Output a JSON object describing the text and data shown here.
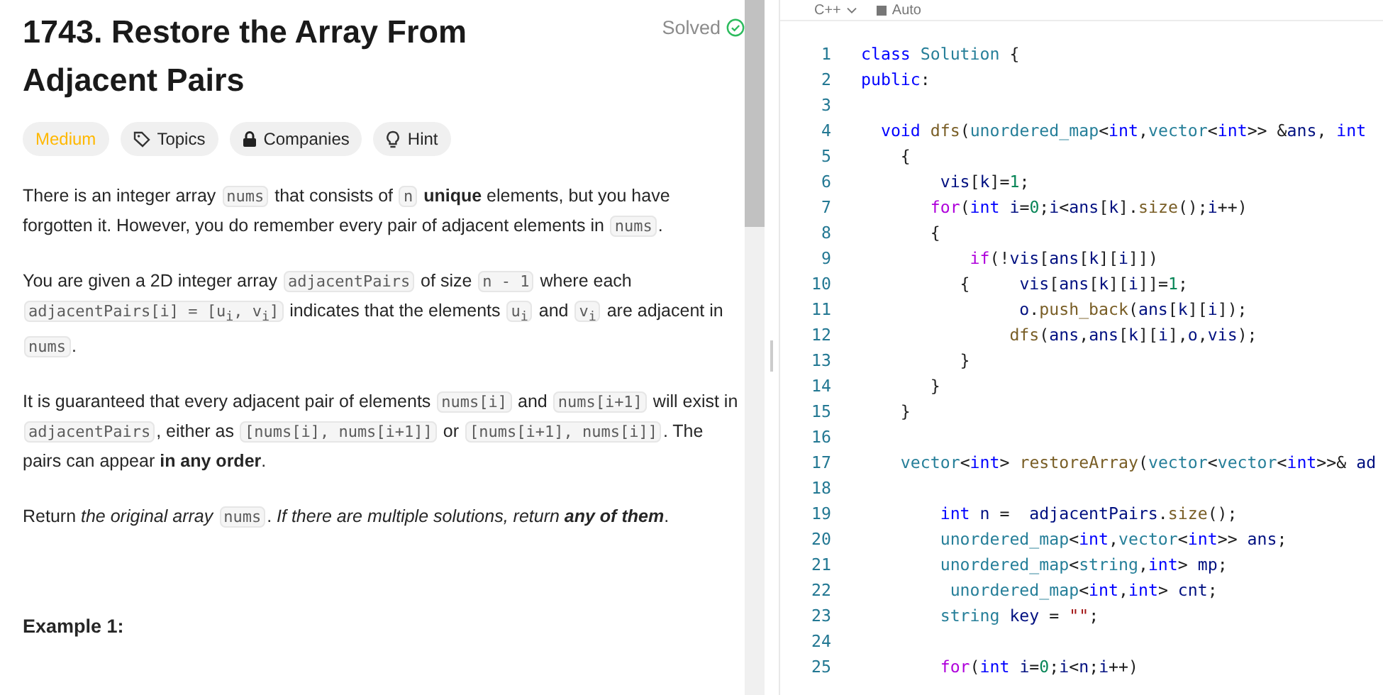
{
  "problem": {
    "title": "1743. Restore the Array From Adjacent Pairs",
    "status": "Solved",
    "difficulty": {
      "kind": "medium",
      "label": "Medium"
    },
    "tags": [
      {
        "kind": "topics",
        "label": "Topics"
      },
      {
        "kind": "companies",
        "label": "Companies"
      },
      {
        "kind": "hint",
        "label": "Hint"
      }
    ],
    "paragraphs": [
      [
        {
          "kind": "text",
          "text": "There is an integer array "
        },
        {
          "kind": "code",
          "text": "nums"
        },
        {
          "kind": "text",
          "text": " that consists of "
        },
        {
          "kind": "code",
          "text": "n"
        },
        {
          "kind": "text",
          "text": " **unique** elements, but you have forgotten it. However, you do remember every pair of adjacent elements in "
        },
        {
          "kind": "code",
          "text": "nums"
        },
        {
          "kind": "text",
          "text": "."
        }
      ],
      [
        {
          "kind": "text",
          "text": "You are given a 2D integer array "
        },
        {
          "kind": "code",
          "text": "adjacentPairs"
        },
        {
          "kind": "text",
          "text": " of size "
        },
        {
          "kind": "code",
          "text": "n - 1"
        },
        {
          "kind": "text",
          "text": " where each "
        },
        {
          "kind": "code",
          "text": "adjacentPairs[i] = [u$_{i}$, v$_{i}$]"
        },
        {
          "kind": "text",
          "text": " indicates that the elements "
        },
        {
          "kind": "code",
          "text": "u$_{i}$"
        },
        {
          "kind": "text",
          "text": " and "
        },
        {
          "kind": "code",
          "text": "v$_{i}$"
        },
        {
          "kind": "text",
          "text": " are adjacent in "
        },
        {
          "kind": "code",
          "text": "nums"
        },
        {
          "kind": "text",
          "text": "."
        }
      ],
      [
        {
          "kind": "text",
          "text": "It is guaranteed that every adjacent pair of elements "
        },
        {
          "kind": "code",
          "text": "nums[i]"
        },
        {
          "kind": "text",
          "text": " and "
        },
        {
          "kind": "code",
          "text": "nums[i+1]"
        },
        {
          "kind": "text",
          "text": " will exist in "
        },
        {
          "kind": "code",
          "text": "adjacentPairs"
        },
        {
          "kind": "text",
          "text": ", either as "
        },
        {
          "kind": "code",
          "text": "[nums[i], nums[i+1]]"
        },
        {
          "kind": "text",
          "text": " or "
        },
        {
          "kind": "code",
          "text": "[nums[i+1], nums[i]]"
        },
        {
          "kind": "text",
          "text": ". The pairs can appear **in any order**."
        }
      ],
      [
        {
          "kind": "text",
          "text": "Return "
        },
        {
          "kind": "italic",
          "text": "the original array "
        },
        {
          "kind": "code",
          "text": "nums"
        },
        {
          "kind": "text",
          "text": ". "
        },
        {
          "kind": "italic",
          "text": "If there are multiple solutions, return **any of them**"
        },
        {
          "kind": "text",
          "text": "."
        }
      ]
    ],
    "example_heading": "Example 1:"
  },
  "editor": {
    "language": "C++",
    "mode": "Auto",
    "lines": [
      {
        "number": "1",
        "tokens": [
          {
            "text": "class ",
            "kind": "kw"
          },
          {
            "text": "Solution",
            "kind": "type"
          },
          {
            "text": " {",
            "kind": "p"
          }
        ]
      },
      {
        "number": "2",
        "tokens": [
          {
            "text": "public",
            "kind": "kw"
          },
          {
            "text": ":",
            "kind": "p"
          }
        ]
      },
      {
        "number": "3"
      },
      {
        "number": "4",
        "tokens": [
          {
            "text": "  void ",
            "kind": "kw"
          },
          {
            "text": "dfs",
            "kind": "fn"
          },
          {
            "text": "(",
            "kind": "p"
          },
          {
            "text": "unordered_map",
            "kind": "type"
          },
          {
            "text": "<",
            "kind": "p"
          },
          {
            "text": "int",
            "kind": "kw"
          },
          {
            "text": ",",
            "kind": "p"
          },
          {
            "text": "vector",
            "kind": "type"
          },
          {
            "text": "<",
            "kind": "p"
          },
          {
            "text": "int",
            "kind": "kw"
          },
          {
            "text": ">> &",
            "kind": "p"
          },
          {
            "text": "ans",
            "kind": "var"
          },
          {
            "text": ", ",
            "kind": "p"
          },
          {
            "text": "int",
            "kind": "kw"
          }
        ]
      },
      {
        "number": "5",
        "tokens": [
          {
            "text": "    {",
            "kind": "p"
          }
        ]
      },
      {
        "number": "6",
        "tokens": [
          {
            "text": "        vis",
            "kind": "var"
          },
          {
            "text": "[",
            "kind": "p"
          },
          {
            "text": "k",
            "kind": "var"
          },
          {
            "text": "]=",
            "kind": "p"
          },
          {
            "text": "1",
            "kind": "num"
          },
          {
            "text": ";",
            "kind": "p"
          }
        ]
      },
      {
        "number": "7",
        "tokens": [
          {
            "text": "       for",
            "kind": "ctrl"
          },
          {
            "text": "(",
            "kind": "p"
          },
          {
            "text": "int ",
            "kind": "kw"
          },
          {
            "text": "i",
            "kind": "var"
          },
          {
            "text": "=",
            "kind": "p"
          },
          {
            "text": "0",
            "kind": "num"
          },
          {
            "text": ";",
            "kind": "p"
          },
          {
            "text": "i",
            "kind": "var"
          },
          {
            "text": "<",
            "kind": "p"
          },
          {
            "text": "ans",
            "kind": "var"
          },
          {
            "text": "[",
            "kind": "p"
          },
          {
            "text": "k",
            "kind": "var"
          },
          {
            "text": "].",
            "kind": "p"
          },
          {
            "text": "size",
            "kind": "fn"
          },
          {
            "text": "();",
            "kind": "p"
          },
          {
            "text": "i",
            "kind": "var"
          },
          {
            "text": "++)",
            "kind": "p"
          }
        ]
      },
      {
        "number": "8",
        "tokens": [
          {
            "text": "       {",
            "kind": "p"
          }
        ]
      },
      {
        "number": "9",
        "tokens": [
          {
            "text": "           if",
            "kind": "ctrl"
          },
          {
            "text": "(!",
            "kind": "p"
          },
          {
            "text": "vis",
            "kind": "var"
          },
          {
            "text": "[",
            "kind": "p"
          },
          {
            "text": "ans",
            "kind": "var"
          },
          {
            "text": "[",
            "kind": "p"
          },
          {
            "text": "k",
            "kind": "var"
          },
          {
            "text": "][",
            "kind": "p"
          },
          {
            "text": "i",
            "kind": "var"
          },
          {
            "text": "]])",
            "kind": "p"
          }
        ]
      },
      {
        "number": "10",
        "tokens": [
          {
            "text": "          {     ",
            "kind": "p"
          },
          {
            "text": "vis",
            "kind": "var"
          },
          {
            "text": "[",
            "kind": "p"
          },
          {
            "text": "ans",
            "kind": "var"
          },
          {
            "text": "[",
            "kind": "p"
          },
          {
            "text": "k",
            "kind": "var"
          },
          {
            "text": "][",
            "kind": "p"
          },
          {
            "text": "i",
            "kind": "var"
          },
          {
            "text": "]]=",
            "kind": "p"
          },
          {
            "text": "1",
            "kind": "num"
          },
          {
            "text": ";",
            "kind": "p"
          }
        ]
      },
      {
        "number": "11",
        "tokens": [
          {
            "text": "                o",
            "kind": "var"
          },
          {
            "text": ".",
            "kind": "p"
          },
          {
            "text": "push_back",
            "kind": "fn"
          },
          {
            "text": "(",
            "kind": "p"
          },
          {
            "text": "ans",
            "kind": "var"
          },
          {
            "text": "[",
            "kind": "p"
          },
          {
            "text": "k",
            "kind": "var"
          },
          {
            "text": "][",
            "kind": "p"
          },
          {
            "text": "i",
            "kind": "var"
          },
          {
            "text": "]);",
            "kind": "p"
          }
        ]
      },
      {
        "number": "12",
        "tokens": [
          {
            "text": "               dfs",
            "kind": "fn"
          },
          {
            "text": "(",
            "kind": "p"
          },
          {
            "text": "ans",
            "kind": "var"
          },
          {
            "text": ",",
            "kind": "p"
          },
          {
            "text": "ans",
            "kind": "var"
          },
          {
            "text": "[",
            "kind": "p"
          },
          {
            "text": "k",
            "kind": "var"
          },
          {
            "text": "][",
            "kind": "p"
          },
          {
            "text": "i",
            "kind": "var"
          },
          {
            "text": "],",
            "kind": "p"
          },
          {
            "text": "o",
            "kind": "var"
          },
          {
            "text": ",",
            "kind": "p"
          },
          {
            "text": "vis",
            "kind": "var"
          },
          {
            "text": ");",
            "kind": "p"
          }
        ]
      },
      {
        "number": "13",
        "tokens": [
          {
            "text": "          }",
            "kind": "p"
          }
        ]
      },
      {
        "number": "14",
        "tokens": [
          {
            "text": "       }",
            "kind": "p"
          }
        ]
      },
      {
        "number": "15",
        "tokens": [
          {
            "text": "    }",
            "kind": "p"
          }
        ]
      },
      {
        "number": "16"
      },
      {
        "number": "17",
        "tokens": [
          {
            "text": "    vector",
            "kind": "type"
          },
          {
            "text": "<",
            "kind": "p"
          },
          {
            "text": "int",
            "kind": "kw"
          },
          {
            "text": "> ",
            "kind": "p"
          },
          {
            "text": "restoreArray",
            "kind": "fn"
          },
          {
            "text": "(",
            "kind": "p"
          },
          {
            "text": "vector",
            "kind": "type"
          },
          {
            "text": "<",
            "kind": "p"
          },
          {
            "text": "vector",
            "kind": "type"
          },
          {
            "text": "<",
            "kind": "p"
          },
          {
            "text": "int",
            "kind": "kw"
          },
          {
            "text": ">>& ",
            "kind": "p"
          },
          {
            "text": "ad",
            "kind": "var"
          }
        ]
      },
      {
        "number": "18"
      },
      {
        "number": "19",
        "tokens": [
          {
            "text": "        int ",
            "kind": "kw"
          },
          {
            "text": "n",
            "kind": "var"
          },
          {
            "text": " =  ",
            "kind": "p"
          },
          {
            "text": "adjacentPairs",
            "kind": "var"
          },
          {
            "text": ".",
            "kind": "p"
          },
          {
            "text": "size",
            "kind": "fn"
          },
          {
            "text": "();",
            "kind": "p"
          }
        ]
      },
      {
        "number": "20",
        "tokens": [
          {
            "text": "        unordered_map",
            "kind": "type"
          },
          {
            "text": "<",
            "kind": "p"
          },
          {
            "text": "int",
            "kind": "kw"
          },
          {
            "text": ",",
            "kind": "p"
          },
          {
            "text": "vector",
            "kind": "type"
          },
          {
            "text": "<",
            "kind": "p"
          },
          {
            "text": "int",
            "kind": "kw"
          },
          {
            "text": ">> ",
            "kind": "p"
          },
          {
            "text": "ans",
            "kind": "var"
          },
          {
            "text": ";",
            "kind": "p"
          }
        ]
      },
      {
        "number": "21",
        "tokens": [
          {
            "text": "        unordered_map",
            "kind": "type"
          },
          {
            "text": "<",
            "kind": "p"
          },
          {
            "text": "string",
            "kind": "type"
          },
          {
            "text": ",",
            "kind": "p"
          },
          {
            "text": "int",
            "kind": "kw"
          },
          {
            "text": "> ",
            "kind": "p"
          },
          {
            "text": "mp",
            "kind": "var"
          },
          {
            "text": ";",
            "kind": "p"
          }
        ]
      },
      {
        "number": "22",
        "tokens": [
          {
            "text": "         unordered_map",
            "kind": "type"
          },
          {
            "text": "<",
            "kind": "p"
          },
          {
            "text": "int",
            "kind": "kw"
          },
          {
            "text": ",",
            "kind": "p"
          },
          {
            "text": "int",
            "kind": "kw"
          },
          {
            "text": "> ",
            "kind": "p"
          },
          {
            "text": "cnt",
            "kind": "var"
          },
          {
            "text": ";",
            "kind": "p"
          }
        ]
      },
      {
        "number": "23",
        "tokens": [
          {
            "text": "        string ",
            "kind": "type"
          },
          {
            "text": "key",
            "kind": "var"
          },
          {
            "text": " = ",
            "kind": "p"
          },
          {
            "text": "\"\"",
            "kind": "str"
          },
          {
            "text": ";",
            "kind": "p"
          }
        ]
      },
      {
        "number": "24"
      },
      {
        "number": "25",
        "tokens": [
          {
            "text": "        for",
            "kind": "ctrl"
          },
          {
            "text": "(",
            "kind": "p"
          },
          {
            "text": "int ",
            "kind": "kw"
          },
          {
            "text": "i",
            "kind": "var"
          },
          {
            "text": "=",
            "kind": "p"
          },
          {
            "text": "0",
            "kind": "num"
          },
          {
            "text": ";",
            "kind": "p"
          },
          {
            "text": "i",
            "kind": "var"
          },
          {
            "text": "<",
            "kind": "p"
          },
          {
            "text": "n",
            "kind": "var"
          },
          {
            "text": ";",
            "kind": "p"
          },
          {
            "text": "i",
            "kind": "var"
          },
          {
            "text": "++)",
            "kind": "p"
          }
        ]
      }
    ]
  }
}
